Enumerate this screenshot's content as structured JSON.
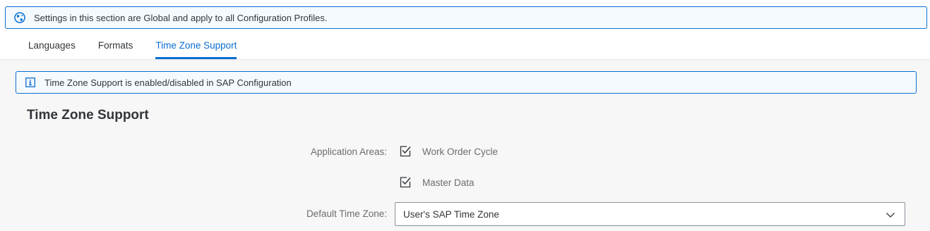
{
  "global_message": {
    "text": "Settings in this section are Global and apply to all Configuration Profiles.",
    "icon": "globe-icon"
  },
  "tabs": [
    {
      "label": "Languages",
      "active": false
    },
    {
      "label": "Formats",
      "active": false
    },
    {
      "label": "Time Zone Support",
      "active": true
    }
  ],
  "info_message": {
    "text": "Time Zone Support is enabled/disabled in SAP Configuration",
    "icon": "info-icon"
  },
  "section": {
    "title": "Time Zone Support"
  },
  "form": {
    "application_areas_label": "Application Areas:",
    "application_areas": [
      {
        "label": "Work Order Cycle",
        "checked": true
      },
      {
        "label": "Master Data",
        "checked": true
      }
    ],
    "default_time_zone_label": "Default Time Zone:",
    "default_time_zone_value": "User's SAP Time Zone"
  },
  "colors": {
    "accent": "#0a6ed1",
    "message_background": "#f5faff",
    "page_background": "#f7f7f7",
    "label_text": "#6a6d70"
  }
}
